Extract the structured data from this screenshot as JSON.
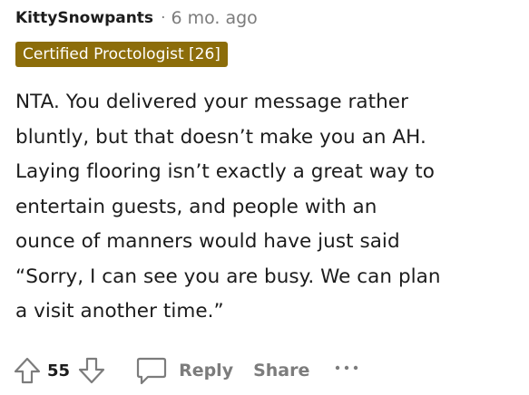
{
  "comment": {
    "author": "KittySnowpants",
    "separator": "·",
    "timestamp": "6 mo. ago",
    "flair": "Certified Proctologist [26]",
    "flair_color": "#8c6d0a",
    "body_lines": [
      "NTA. You delivered your message rather",
      "bluntly, but that doesn’t make you an AH.",
      "Laying flooring isn’t exactly a great way to",
      "entertain guests, and people with an",
      "ounce of manners would have just said",
      "“Sorry, I can see you are busy. We can plan",
      "a visit another time.”"
    ]
  },
  "actions": {
    "upvote_icon": "arrow-up-icon",
    "vote_count": "55",
    "downvote_icon": "arrow-down-icon",
    "reply_icon": "speech-bubble-icon",
    "reply_label": "Reply",
    "share_label": "Share",
    "more_icon": "ellipsis-icon"
  }
}
